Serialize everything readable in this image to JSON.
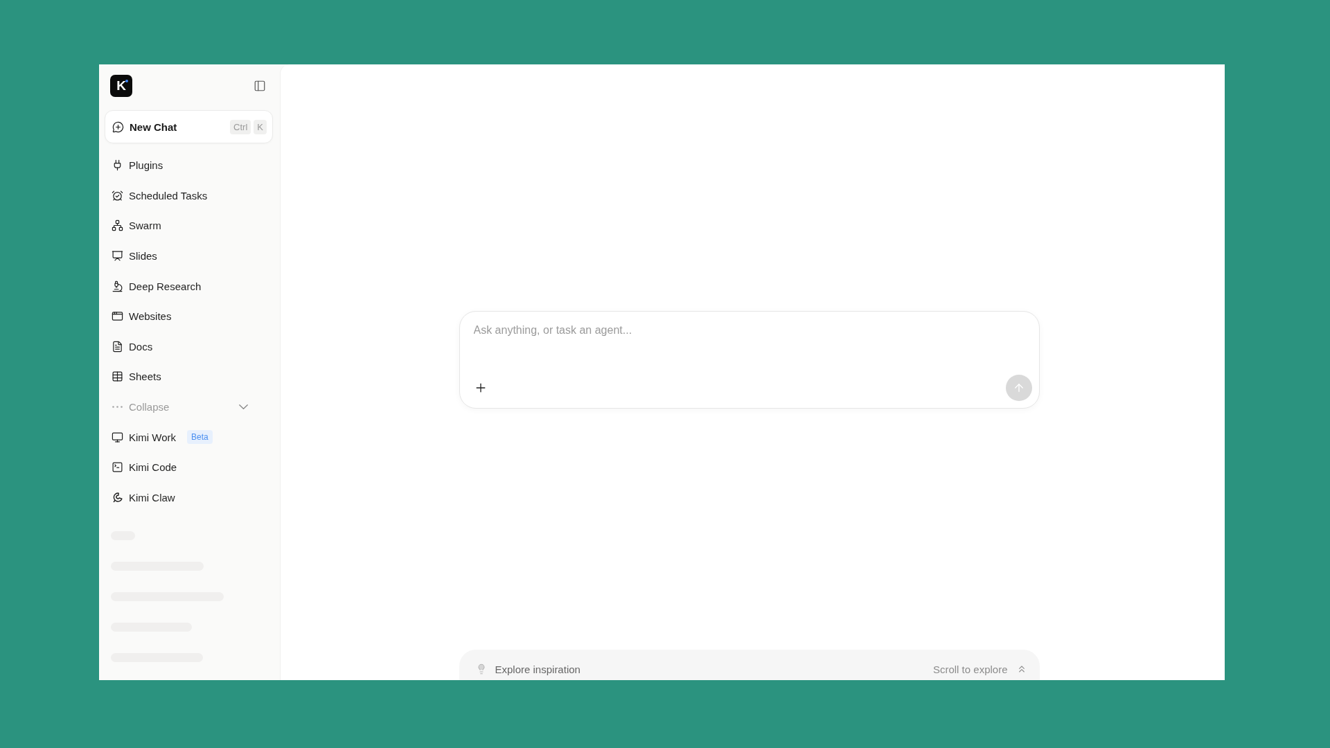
{
  "logo": {
    "text": "K"
  },
  "sidebar": {
    "new_chat": {
      "label": "New Chat",
      "shortcut": [
        "Ctrl",
        "K"
      ]
    },
    "items": [
      {
        "label": "Plugins",
        "selected": false
      },
      {
        "label": "Scheduled Tasks",
        "selected": false
      },
      {
        "label": "Swarm",
        "selected": false
      },
      {
        "label": "Slides",
        "selected": false
      },
      {
        "label": "Deep Research",
        "selected": false
      },
      {
        "label": "Websites",
        "selected": false
      },
      {
        "label": "Docs",
        "selected": false
      },
      {
        "label": "Sheets",
        "selected": false
      }
    ],
    "collapse": {
      "label": "Collapse",
      "expanded": true
    },
    "products": [
      {
        "label": "Kimi Work",
        "badge": "Beta",
        "selected": false
      },
      {
        "label": "Kimi Code",
        "selected": false
      },
      {
        "label": "Kimi Claw",
        "selected": false
      }
    ]
  },
  "composer": {
    "placeholder": "Ask anything, or task an agent...",
    "send_button": {
      "disabled": true
    }
  },
  "explore_bar": {
    "label": "Explore inspiration",
    "hint": "Scroll to explore"
  }
}
